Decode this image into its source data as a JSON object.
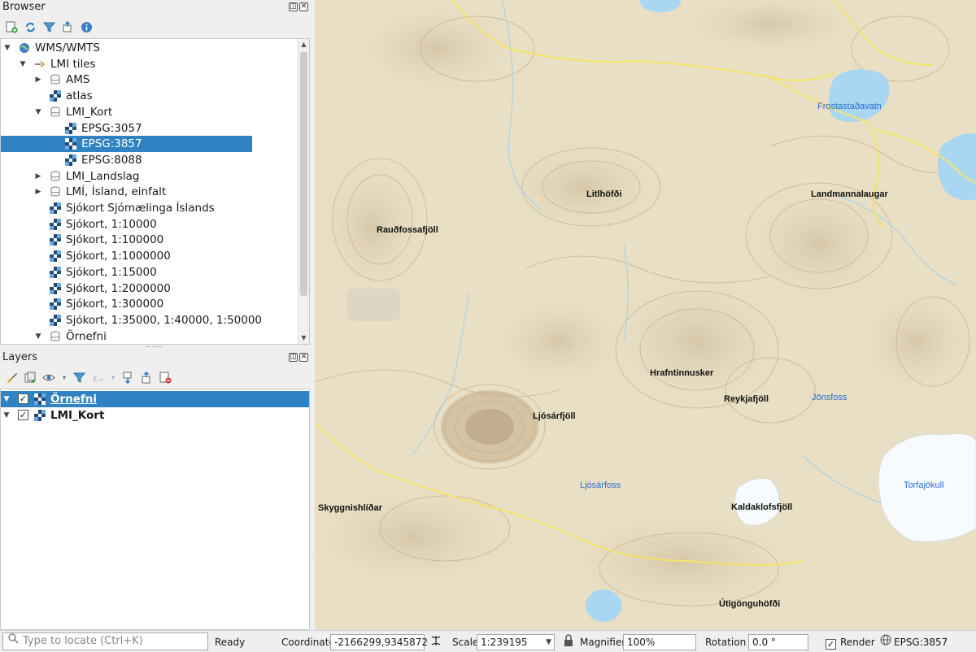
{
  "browser": {
    "title": "Browser",
    "tree": [
      {
        "label": "WMS/WMTS",
        "level": 0,
        "arrow": "down",
        "icon": "globe-icon"
      },
      {
        "label": "LMI tiles",
        "level": 1,
        "arrow": "down",
        "icon": "wms-connection-icon"
      },
      {
        "label": "AMS",
        "level": 2,
        "arrow": "right",
        "icon": "database-icon"
      },
      {
        "label": "atlas",
        "level": 2,
        "arrow": "",
        "icon": "raster-layer-icon"
      },
      {
        "label": "LMI_Kort",
        "level": 2,
        "arrow": "down",
        "icon": "database-icon"
      },
      {
        "label": "EPSG:3057",
        "level": 3,
        "arrow": "",
        "icon": "raster-layer-icon"
      },
      {
        "label": "EPSG:3857",
        "level": 3,
        "arrow": "",
        "icon": "raster-layer-icon",
        "selected": true
      },
      {
        "label": "EPSG:8088",
        "level": 3,
        "arrow": "",
        "icon": "raster-layer-icon"
      },
      {
        "label": "LMI_Landslag",
        "level": 2,
        "arrow": "right",
        "icon": "database-icon"
      },
      {
        "label": "LMÍ, Ísland, einfalt",
        "level": 2,
        "arrow": "right",
        "icon": "database-icon"
      },
      {
        "label": "Sjókort Sjómælinga Íslands",
        "level": 2,
        "arrow": "",
        "icon": "raster-layer-icon"
      },
      {
        "label": "Sjókort, 1:10000",
        "level": 2,
        "arrow": "",
        "icon": "raster-layer-icon"
      },
      {
        "label": "Sjókort, 1:100000",
        "level": 2,
        "arrow": "",
        "icon": "raster-layer-icon"
      },
      {
        "label": "Sjókort, 1:1000000",
        "level": 2,
        "arrow": "",
        "icon": "raster-layer-icon"
      },
      {
        "label": "Sjókort, 1:15000",
        "level": 2,
        "arrow": "",
        "icon": "raster-layer-icon"
      },
      {
        "label": "Sjókort, 1:2000000",
        "level": 2,
        "arrow": "",
        "icon": "raster-layer-icon"
      },
      {
        "label": "Sjókort, 1:300000",
        "level": 2,
        "arrow": "",
        "icon": "raster-layer-icon"
      },
      {
        "label": "Sjókort, 1:35000, 1:40000, 1:50000",
        "level": 2,
        "arrow": "",
        "icon": "raster-layer-icon"
      },
      {
        "label": "Örnefni",
        "level": 2,
        "arrow": "down",
        "icon": "database-icon"
      }
    ]
  },
  "layers": {
    "title": "Layers",
    "items": [
      {
        "label": "Örnefni",
        "checked": true,
        "selected": true
      },
      {
        "label": "LMI_Kort",
        "checked": true,
        "selected": false
      }
    ]
  },
  "map": {
    "places": [
      {
        "label": "Frostastaðavatn",
        "water": true
      },
      {
        "label": "Litlhöfði",
        "water": false
      },
      {
        "label": "Landmannalaugar",
        "water": false
      },
      {
        "label": "Rauðfossafjöll",
        "water": false
      },
      {
        "label": "Hrafntinnusker",
        "water": false
      },
      {
        "label": "Reykjafjöll",
        "water": false
      },
      {
        "label": "Jönsfoss",
        "water": true
      },
      {
        "label": "Ljósárfjöll",
        "water": false
      },
      {
        "label": "Ljósárfoss",
        "water": true
      },
      {
        "label": "Torfajökull",
        "water": true
      },
      {
        "label": "Skyggnishlíðar",
        "water": false
      },
      {
        "label": "Kaldaklofsfjöll",
        "water": false
      },
      {
        "label": "Útigönguhöfði",
        "water": false
      }
    ]
  },
  "statusbar": {
    "locate_placeholder": "Type to locate (Ctrl+K)",
    "ready": "Ready",
    "coordinate_label": "Coordinate",
    "coordinate_value": "-2166299,9345872",
    "scale_label": "Scale",
    "scale_value": "1:239195",
    "magnifier_label": "Magnifier",
    "magnifier_value": "100%",
    "rotation_label": "Rotation",
    "rotation_value": "0.0 °",
    "render_label": "Render",
    "crs_label": "EPSG:3857"
  },
  "colors": {
    "selection": "#2f83c3",
    "map_terrain": "#e9dfc4",
    "water": "#a9d7f2",
    "glacier": "#f7fbfd",
    "road": "#f2e36a",
    "contour": "#c7a987",
    "place_water_label": "#2a6ed1"
  }
}
